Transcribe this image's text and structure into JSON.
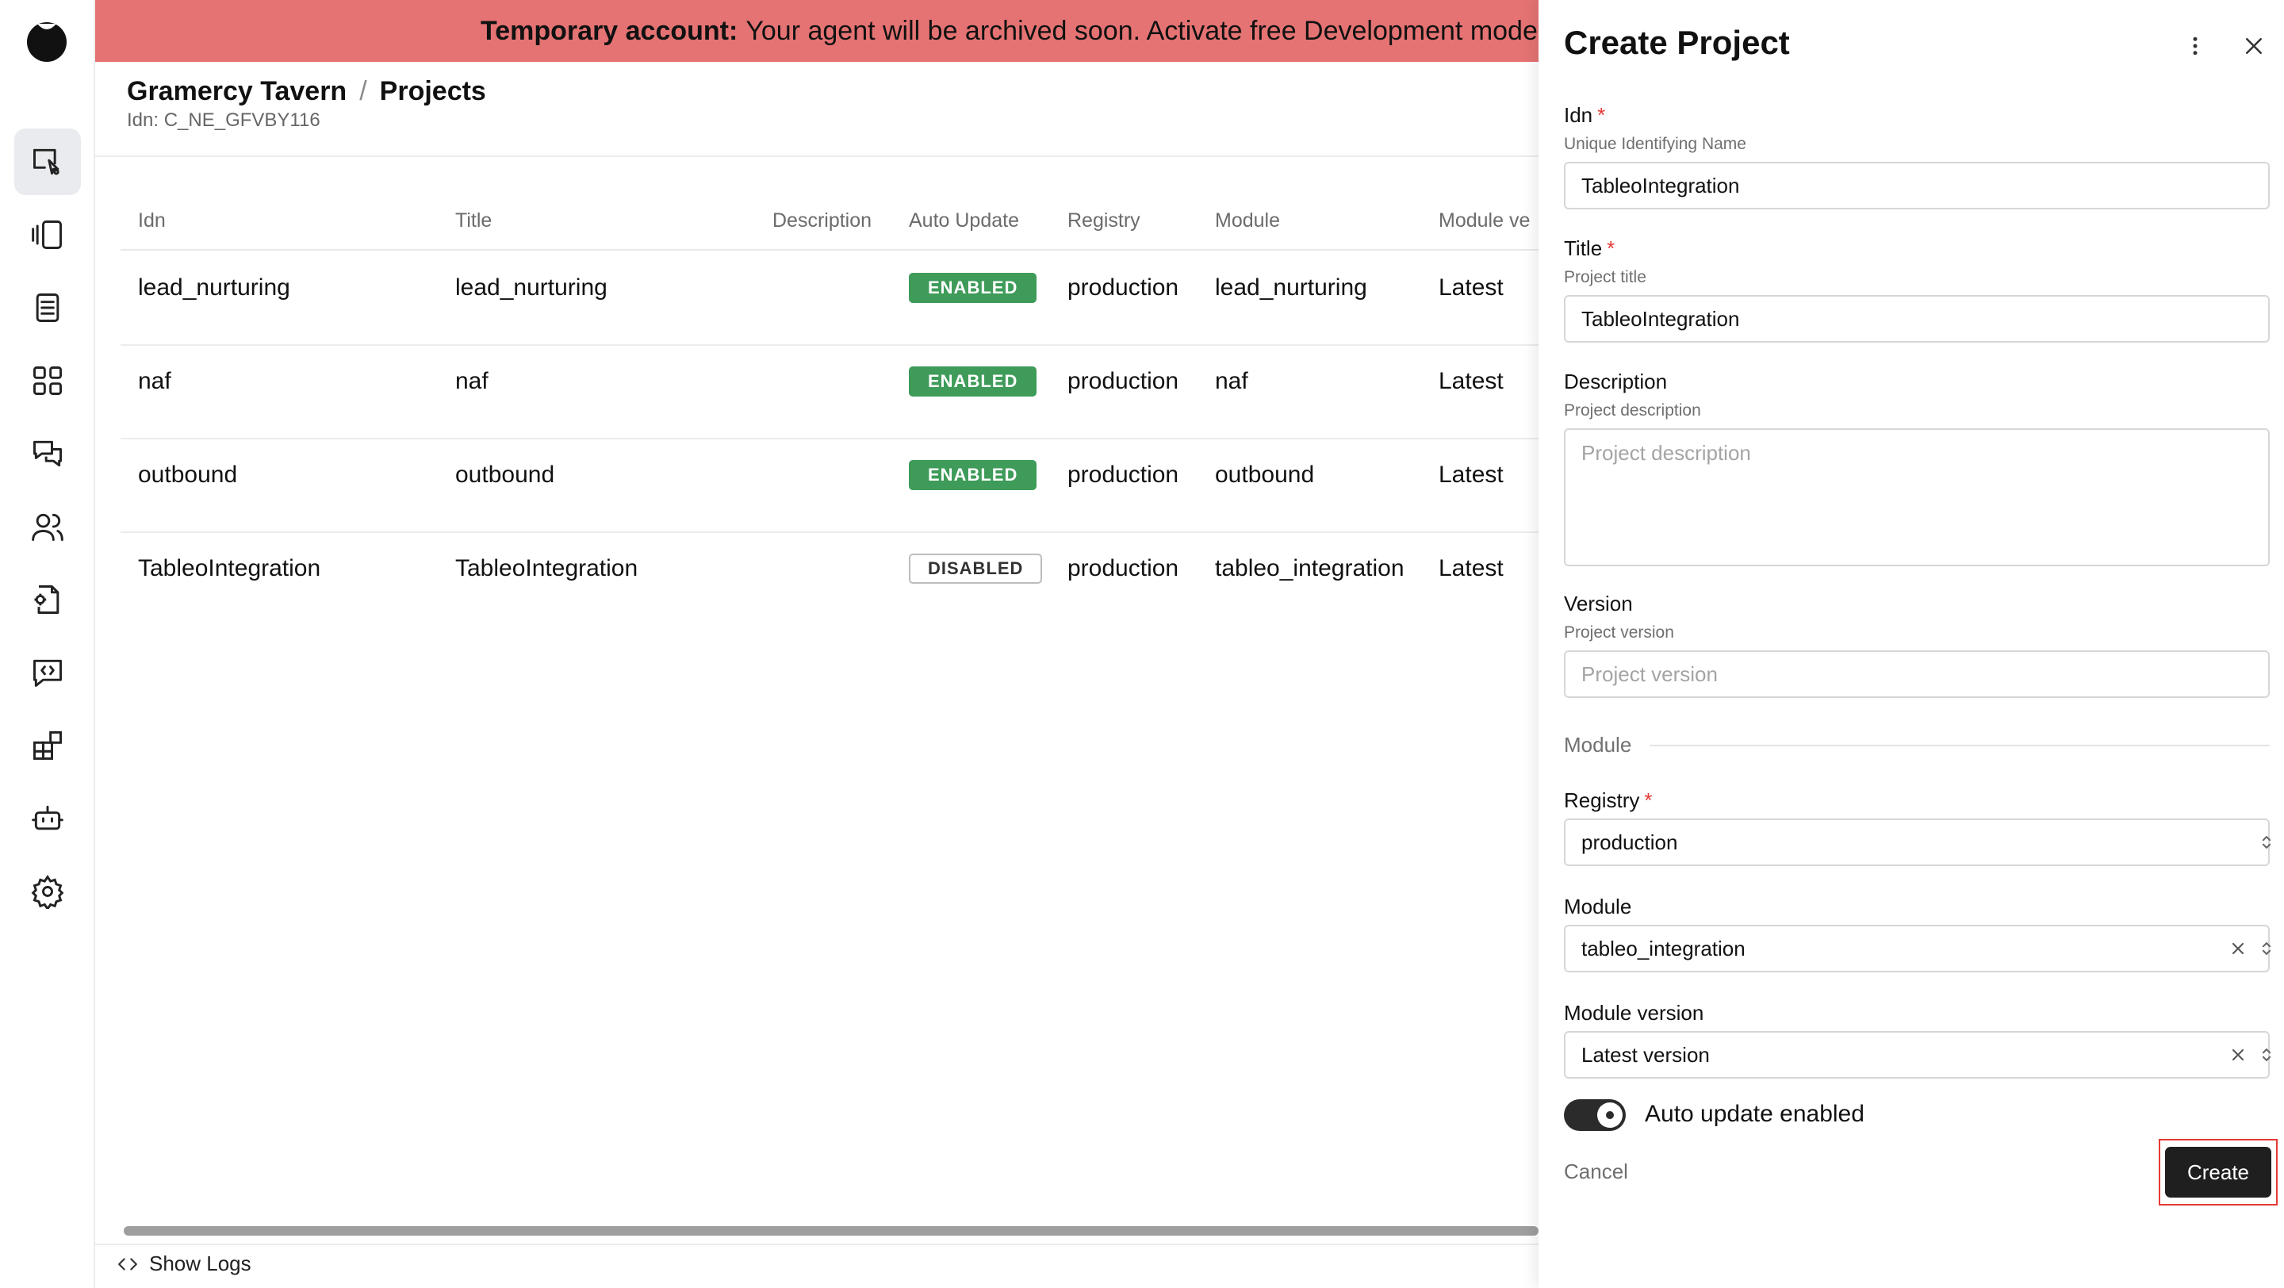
{
  "banner": {
    "bold": "Temporary account:",
    "text": "Your agent will be archived soon. Activate free Development mode"
  },
  "breadcrumb": {
    "org": "Gramercy Tavern",
    "separator": "/",
    "page": "Projects"
  },
  "idn_sub": "Idn: C_NE_GFVBY116",
  "table": {
    "headers": {
      "idn": "Idn",
      "title": "Title",
      "description": "Description",
      "auto_update": "Auto Update",
      "registry": "Registry",
      "module": "Module",
      "module_version": "Module ve"
    },
    "rows": [
      {
        "idn": "lead_nurturing",
        "title": "lead_nurturing",
        "description": "",
        "auto_update": "ENABLED",
        "registry": "production",
        "module": "lead_nurturing",
        "module_version": "Latest"
      },
      {
        "idn": "naf",
        "title": "naf",
        "description": "",
        "auto_update": "ENABLED",
        "registry": "production",
        "module": "naf",
        "module_version": "Latest"
      },
      {
        "idn": "outbound",
        "title": "outbound",
        "description": "",
        "auto_update": "ENABLED",
        "registry": "production",
        "module": "outbound",
        "module_version": "Latest"
      },
      {
        "idn": "TableoIntegration",
        "title": "TableoIntegration",
        "description": "",
        "auto_update": "DISABLED",
        "registry": "production",
        "module": "tableo_integration",
        "module_version": "Latest"
      }
    ]
  },
  "footer": {
    "show_logs": "Show Logs"
  },
  "drawer": {
    "title": "Create Project",
    "idn": {
      "label": "Idn",
      "required": "*",
      "hint": "Unique Identifying Name",
      "value": "TableoIntegration"
    },
    "title_field": {
      "label": "Title",
      "required": "*",
      "hint": "Project title",
      "value": "TableoIntegration"
    },
    "description": {
      "label": "Description",
      "hint": "Project description",
      "placeholder": "Project description"
    },
    "version": {
      "label": "Version",
      "hint": "Project version",
      "placeholder": "Project version"
    },
    "module_section": "Module",
    "registry": {
      "label": "Registry",
      "required": "*",
      "value": "production"
    },
    "module": {
      "label": "Module",
      "value": "tableo_integration"
    },
    "module_version": {
      "label": "Module version",
      "value": "Latest version"
    },
    "auto_update": {
      "label": "Auto update enabled",
      "enabled": true
    },
    "cancel_label": "Cancel",
    "create_label": "Create"
  },
  "colors": {
    "banner": "#e57373",
    "enabled_badge": "#3e9b59",
    "primary_button": "#1f1f1f",
    "required": "#e53935",
    "highlight_outline": "#e53935"
  },
  "icons": {
    "rail": [
      "brand-logo-icon",
      "projects-icon",
      "flows-icon",
      "docs-icon",
      "apps-grid-icon",
      "chat-icon",
      "users-icon",
      "file-settings-icon",
      "code-chat-icon",
      "integrations-icon",
      "bot-icon",
      "settings-icon"
    ]
  }
}
